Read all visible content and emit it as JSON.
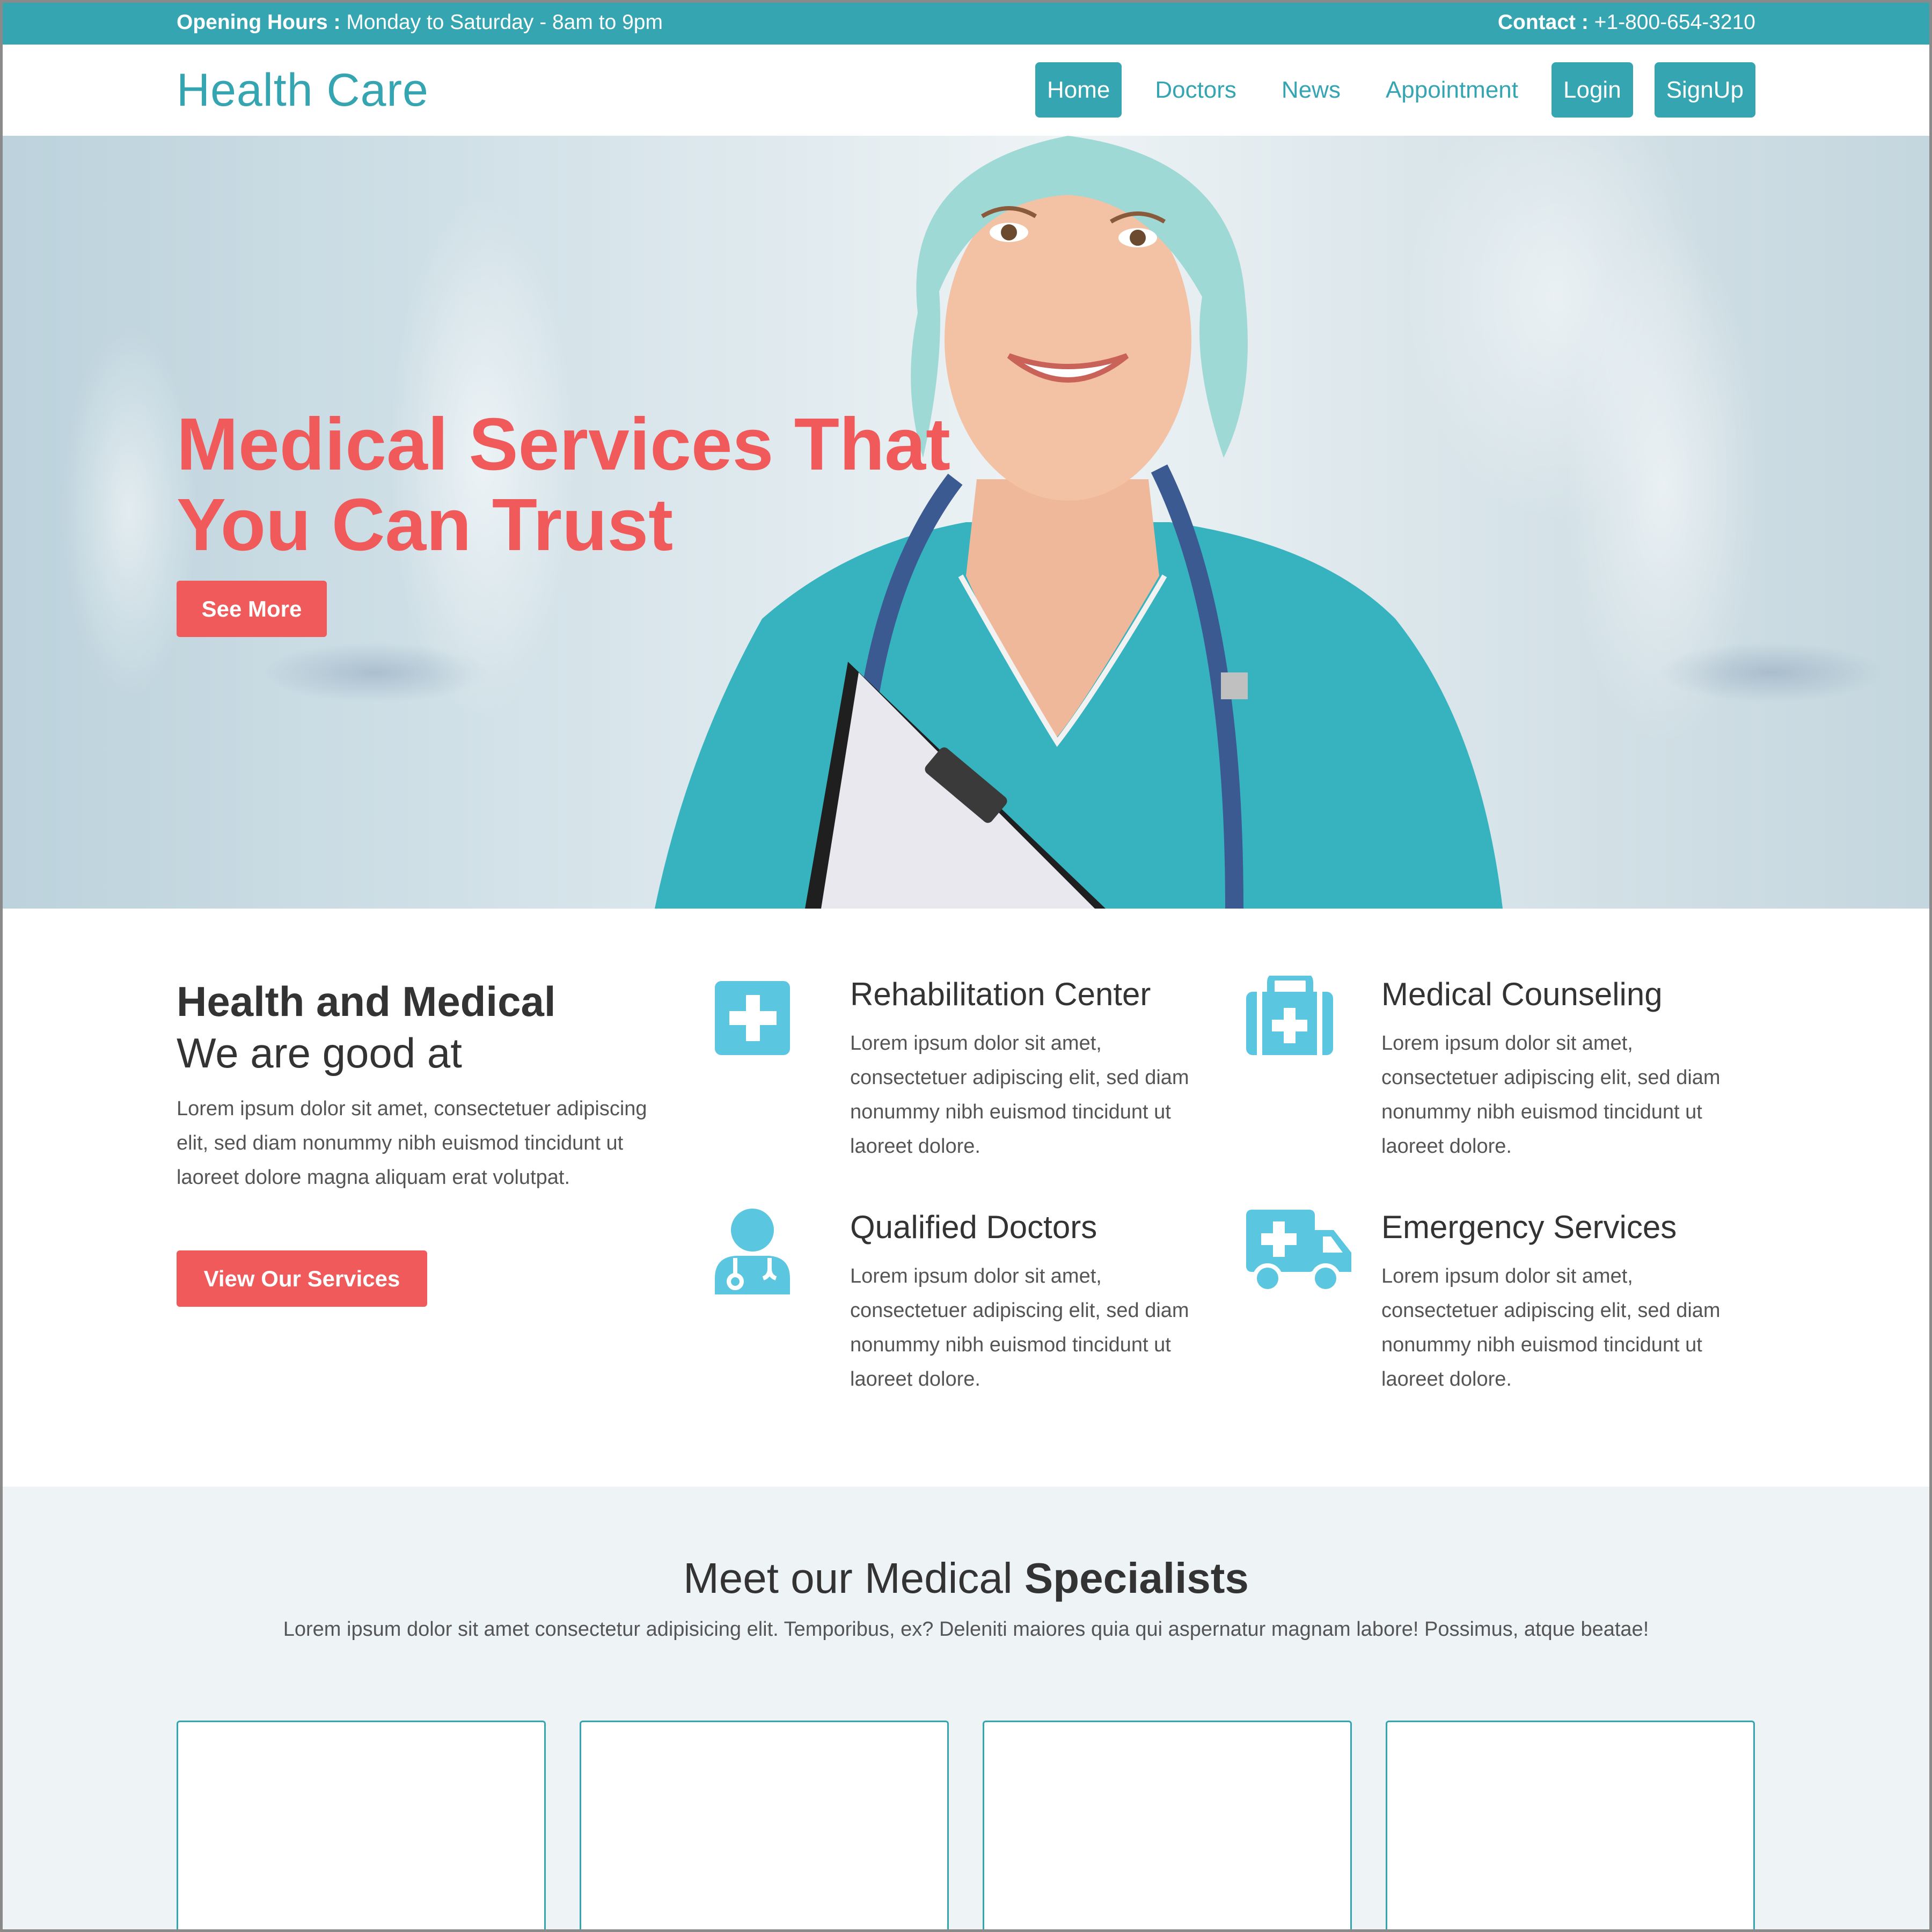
{
  "topbar": {
    "hours_label": "Opening Hours :",
    "hours_value": " Monday to Saturday - 8am to 9pm",
    "contact_label": "Contact :",
    "contact_value": " +1-800-654-3210"
  },
  "header": {
    "logo": "Health Care",
    "nav": [
      "Home",
      "Doctors",
      "News",
      "Appointment",
      "Login",
      "SignUp"
    ]
  },
  "hero": {
    "title_line1": "Medical Services That",
    "title_line2": "You Can Trust",
    "button": "See More"
  },
  "services_intro": {
    "heading_bold": "Health and Medical",
    "heading_light": "We are good at",
    "text": "Lorem ipsum dolor sit amet, consectetuer adipiscing elit, sed diam nonummy nibh euismod tincidunt ut laoreet dolore magna aliquam erat volutpat.",
    "button": "View Our Services"
  },
  "services": [
    {
      "title": "Rehabilitation Center",
      "icon": "plus-square-icon",
      "text": "Lorem ipsum dolor sit amet, consectetuer adipiscing elit, sed diam nonummy nibh euismod tincidunt ut laoreet dolore."
    },
    {
      "title": "Medical Counseling",
      "icon": "medical-kit-icon",
      "text": "Lorem ipsum dolor sit amet, consectetuer adipiscing elit, sed diam nonummy nibh euismod tincidunt ut laoreet dolore."
    },
    {
      "title": "Qualified Doctors",
      "icon": "doctor-icon",
      "text": "Lorem ipsum dolor sit amet, consectetuer adipiscing elit, sed diam nonummy nibh euismod tincidunt ut laoreet dolore."
    },
    {
      "title": "Emergency Services",
      "icon": "ambulance-icon",
      "text": "Lorem ipsum dolor sit amet, consectetuer adipiscing elit, sed diam nonummy nibh euismod tincidunt ut laoreet dolore."
    }
  ],
  "specialists": {
    "title_light": "Meet our Medical ",
    "title_bold": "Specialists",
    "subtitle": "Lorem ipsum dolor sit amet consectetur adipisicing elit. Temporibus, ex? Deleniti maiores quia qui aspernatur magnam labore! Possimus, atque beatae!"
  },
  "colors": {
    "accent": "#34a5b1",
    "cta": "#f15a5a",
    "icon": "#5bc6df",
    "section_bg": "#eef3f6"
  }
}
